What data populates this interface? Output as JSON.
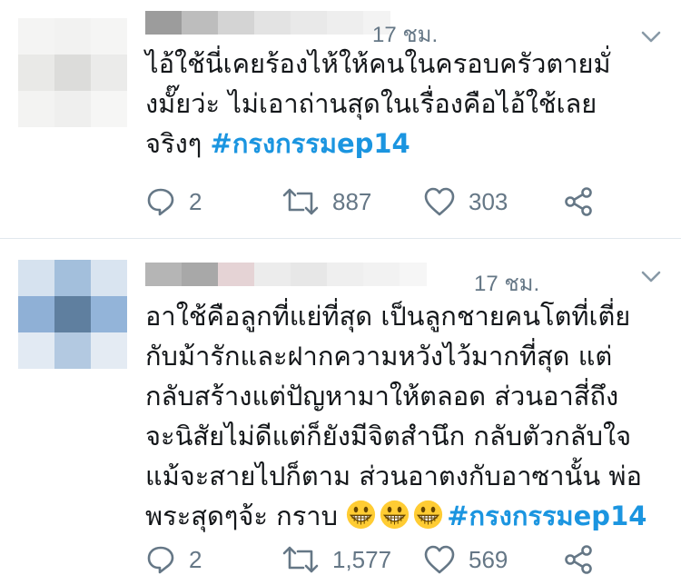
{
  "colors": {
    "text": "#14171a",
    "secondary": "#657786",
    "hashtag": "#1b95e0",
    "divider": "#e1e8ed"
  },
  "tweets": [
    {
      "time": "17 ชม.",
      "text_lines": [
        "ไอ้ใช้นี่เคยร้องไห้ให้คนในครอบครัวตายมั่",
        "งมั๊ยว่ะ ไม่เอาถ่านสุดในเรื่องคือไอ้ใช้เลย",
        "จริงๆ "
      ],
      "hashtag": "#กรงกรรมep14",
      "replies": "2",
      "retweets": "887",
      "likes": "303"
    },
    {
      "time": "17 ชม.",
      "text_lines": [
        "อาใช้คือลูกที่แย่ที่สุด เป็นลูกชายคนโตที่เตี่ย",
        "กับม้ารักและฝากความหวังไว้มากที่สุด แต่",
        "กลับสร้างแต่ปัญหามาให้ตลอด ส่วนอาสี่ถึง",
        "จะนิสัยไม่ดีแต่ก็ยังมีจิตสำนึก กลับตัวกลับใจ",
        "แม้จะสายไปก็ตาม ส่วนอาตงกับอาซานั้น พ่อ",
        "พระสุดๆจ้ะ กราบ "
      ],
      "hashtag": "#กรงกรรมep14",
      "emojis": [
        "grinning-face-emoji",
        "grinning-face-emoji",
        "grinning-face-emoji"
      ],
      "replies": "2",
      "retweets": "1,577",
      "likes": "569"
    }
  ]
}
